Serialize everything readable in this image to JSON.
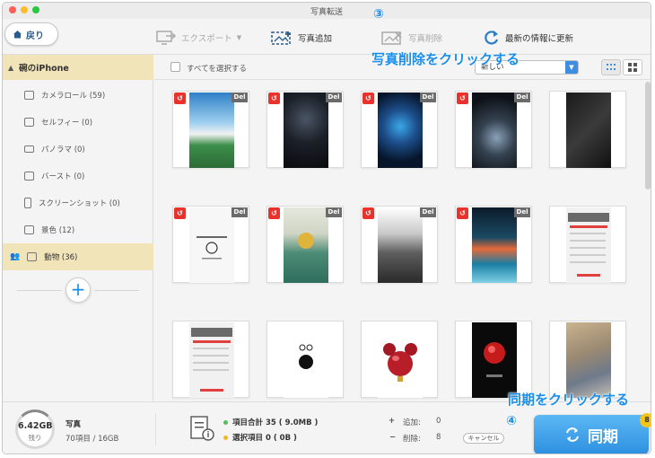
{
  "window": {
    "title": "写真転送"
  },
  "toolbar": {
    "back_label": "戻り",
    "export_label": "エクスポート",
    "add_label": "写真追加",
    "delete_label": "写真削除",
    "refresh_label": "最新の情報に更新"
  },
  "annotations": {
    "step3": "③",
    "step3_text": "写真削除をクリックする",
    "step4": "④",
    "step4_text": "同期をクリックする"
  },
  "sidebar": {
    "device": "碗のiPhone",
    "items": [
      {
        "label": "カメラロール (59)",
        "icon": "camera-icon"
      },
      {
        "label": "セルフィー (0)",
        "icon": "selfie-icon"
      },
      {
        "label": "パノラマ (0)",
        "icon": "panorama-icon"
      },
      {
        "label": "バースト (0)",
        "icon": "burst-icon"
      },
      {
        "label": "スクリーンショット (0)",
        "icon": "phone-icon"
      },
      {
        "label": "景色 (12)",
        "icon": "landscape-icon"
      },
      {
        "label": "動物 (36)",
        "icon": "album-icon",
        "active": true
      }
    ]
  },
  "content": {
    "select_all_label": "すべてを選択する",
    "sort_value": "新しい",
    "del_label": "Del"
  },
  "bottom": {
    "storage_value": "6.42GB",
    "storage_left_label": "残り",
    "category": "写真",
    "category_count": "70項目 / 16GB",
    "total_label": "項目合計 35 ( 9.0MB )",
    "selected_label": "選択項目 0 ( 0B )",
    "add_label": "追加:",
    "add_count": "0",
    "delete_label": "削除:",
    "delete_count": "8",
    "cancel_label": "キャンセル",
    "sync_label": "同期",
    "sync_badge": "8"
  },
  "colors": {
    "accent": "#1a8ee8",
    "active_bg": "#f2e4b9",
    "del_badge": "#e8322b"
  }
}
